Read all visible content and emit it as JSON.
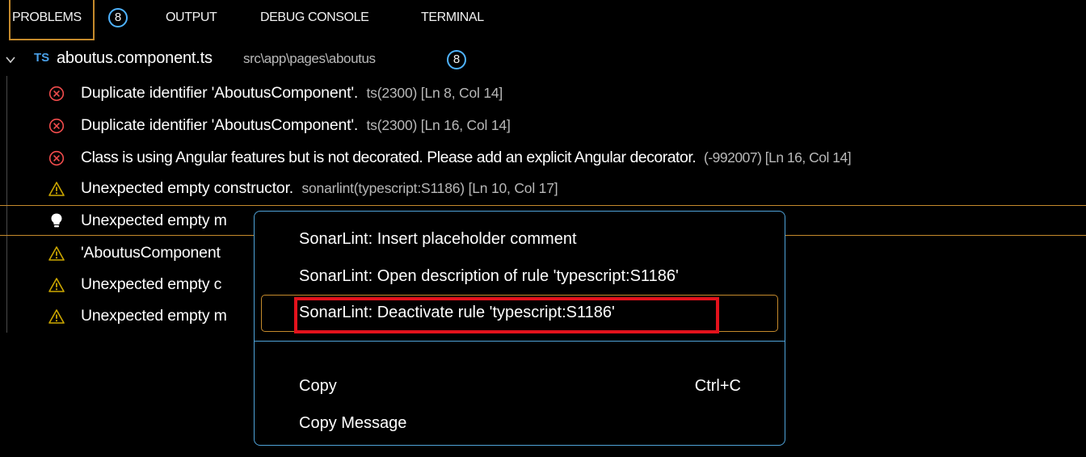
{
  "panel": {
    "tabs": [
      {
        "label": "PROBLEMS"
      },
      {
        "label": "OUTPUT"
      },
      {
        "label": "DEBUG CONSOLE"
      },
      {
        "label": "TERMINAL"
      }
    ],
    "problems_count": "8",
    "active_tab_color": "#c58a2c",
    "badge_color": "#4fb3ff"
  },
  "file": {
    "icon": "TS",
    "name": "aboutus.component.ts",
    "path": "src\\app\\pages\\aboutus",
    "count": "8"
  },
  "problems": [
    {
      "severity": "error",
      "icon": "error-circle-icon",
      "message": "Duplicate identifier 'AboutusComponent'.",
      "source": "ts(2300)  [Ln 8, Col 14]"
    },
    {
      "severity": "error",
      "icon": "error-circle-icon",
      "message": "Duplicate identifier 'AboutusComponent'.",
      "source": "ts(2300)  [Ln 16, Col 14]"
    },
    {
      "severity": "error",
      "icon": "error-circle-icon",
      "message": "Class is using Angular features but is not decorated. Please add an explicit Angular decorator.",
      "source": "(-992007)  [Ln 16, Col 14]"
    },
    {
      "severity": "warning",
      "icon": "warning-triangle-icon",
      "message": "Unexpected empty constructor.",
      "source": "sonarlint(typescript:S1186)  [Ln 10, Col 17]"
    },
    {
      "severity": "quickfix",
      "icon": "lightbulb-icon",
      "message": "Unexpected empty m",
      "source": ""
    },
    {
      "severity": "warning",
      "icon": "warning-triangle-icon",
      "message": "'AboutusComponent",
      "source": ""
    },
    {
      "severity": "warning",
      "icon": "warning-triangle-icon",
      "message": "Unexpected empty c",
      "source": ""
    },
    {
      "severity": "warning",
      "icon": "warning-triangle-icon",
      "message": "Unexpected empty m",
      "source": ""
    }
  ],
  "context_menu": {
    "items": [
      {
        "label": "SonarLint: Insert placeholder comment",
        "shortcut": ""
      },
      {
        "label": "SonarLint: Open description of rule 'typescript:S1186'",
        "shortcut": ""
      },
      {
        "label": "SonarLint: Deactivate rule 'typescript:S1186'",
        "shortcut": ""
      },
      {
        "label": "Copy",
        "shortcut": "Ctrl+C"
      },
      {
        "label": "Copy Message",
        "shortcut": ""
      }
    ],
    "border_color": "#4fa3d9",
    "focus_color": "#c58a2c",
    "annotation_color": "#e3121c"
  },
  "colors": {
    "background": "#000000",
    "error": "#f14c4c",
    "warning": "#cca700",
    "lightbulb": "#ffffff"
  }
}
